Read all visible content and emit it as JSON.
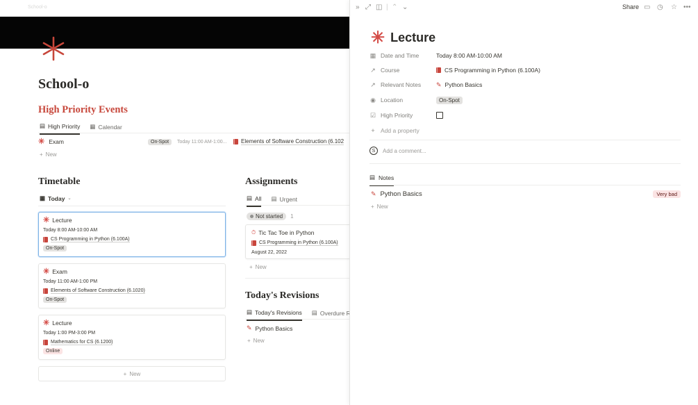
{
  "left": {
    "breadcrumb": "School-o",
    "page_title": "School-o",
    "high_priority": {
      "title": "High Priority Events",
      "tabs": [
        "High Priority",
        "Calendar"
      ],
      "row": {
        "name": "Exam",
        "location": "On-Spot",
        "time": "Today 11:00 AM-1:00...",
        "course": "Elements of Software Construction (6.102"
      },
      "new_label": "New"
    },
    "timetable": {
      "title": "Timetable",
      "view": "Today",
      "cards": [
        {
          "title": "Lecture",
          "time": "Today 8:00 AM-10:00 AM",
          "course": "CS Programming in Python (6.100A)",
          "location": "On-Spot"
        },
        {
          "title": "Exam",
          "time": "Today 11:00 AM-1:00 PM",
          "course": "Elements of Software Construction (6.1020)",
          "location": "On-Spot"
        },
        {
          "title": "Lecture",
          "time": "Today 1:00 PM-3:00 PM",
          "course": "Mathematics for CS (6.1200)",
          "location": "Online"
        }
      ],
      "new_label": "New"
    },
    "assignments": {
      "title": "Assignments",
      "tabs": [
        "All",
        "Urgent"
      ],
      "group_label": "Not started",
      "group_count": "1",
      "card": {
        "title": "Tic Tac Toe in Python",
        "course": "CS Programming in Python (6.100A)",
        "date": "August 22, 2022"
      },
      "new_label": "New"
    },
    "revisions": {
      "title": "Today's Revisions",
      "tabs": [
        "Today's Revisions",
        "Overdure Revisi"
      ],
      "item": "Python Basics",
      "new_label": "New"
    }
  },
  "peek": {
    "toolbar": {
      "share": "Share"
    },
    "title": "Lecture",
    "properties": [
      {
        "label": "Date and Time",
        "value": "Today 8:00 AM-10:00 AM"
      },
      {
        "label": "Course",
        "value": "CS Programming in Python (6.100A)"
      },
      {
        "label": "Relevant Notes",
        "value": "Python Basics"
      },
      {
        "label": "Location",
        "value": "On-Spot"
      },
      {
        "label": "High Priority",
        "value": ""
      }
    ],
    "add_property": "Add a property",
    "comment_placeholder": "Add a comment...",
    "avatar_letter": "S",
    "notes": {
      "tab": "Notes",
      "item": "Python Basics",
      "badge": "Very bad",
      "new_label": "New"
    }
  },
  "colors": {
    "accent_red": "#c7473b",
    "cover": "#050505",
    "selection": "#7fb3e6"
  }
}
